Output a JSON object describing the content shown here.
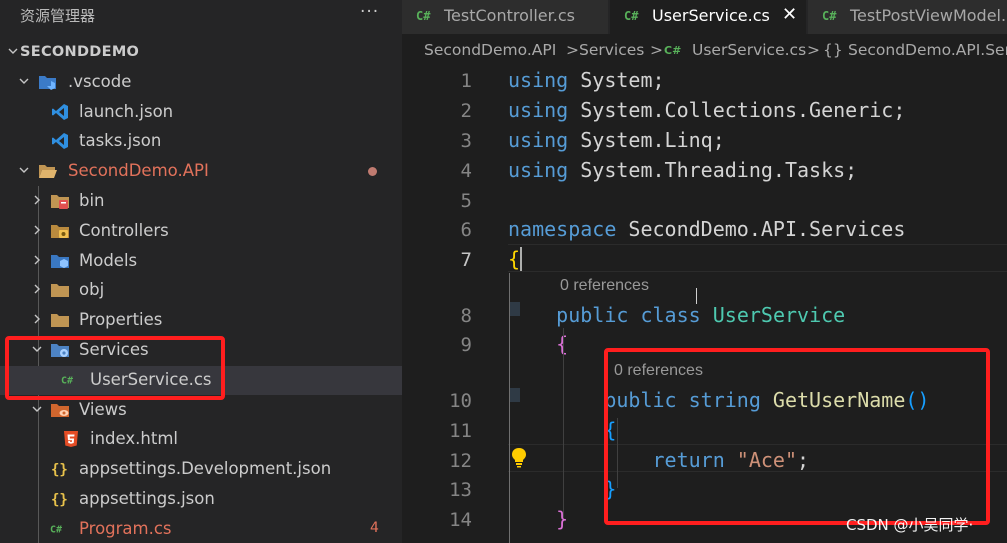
{
  "sidebar": {
    "title": "资源管理器",
    "more": "···",
    "tree": [
      {
        "label": "SECONDDEMO",
        "chevron": "down",
        "icon": "none",
        "root": true
      },
      {
        "label": ".vscode",
        "chevron": "down",
        "icon": "folder-vscode-icon"
      },
      {
        "label": "launch.json",
        "chevron": "none",
        "icon": "vscode-file-icon"
      },
      {
        "label": "tasks.json",
        "chevron": "none",
        "icon": "vscode-file-icon"
      },
      {
        "label": "SecondDemo.API",
        "chevron": "down",
        "icon": "folder-open-icon",
        "modified": true
      },
      {
        "label": "bin",
        "chevron": "right",
        "icon": "folder-bin-icon"
      },
      {
        "label": "Controllers",
        "chevron": "right",
        "icon": "folder-controllers-icon"
      },
      {
        "label": "Models",
        "chevron": "right",
        "icon": "folder-models-icon"
      },
      {
        "label": "obj",
        "chevron": "right",
        "icon": "folder-icon"
      },
      {
        "label": "Properties",
        "chevron": "right",
        "icon": "folder-icon"
      },
      {
        "label": "Services",
        "chevron": "down",
        "icon": "folder-services-icon"
      },
      {
        "label": "UserService.cs",
        "chevron": "none",
        "icon": "csharp-file-icon",
        "selected": true
      },
      {
        "label": "Views",
        "chevron": "down",
        "icon": "folder-views-icon"
      },
      {
        "label": "index.html",
        "chevron": "none",
        "icon": "html-file-icon"
      },
      {
        "label": "appsettings.Development.json",
        "chevron": "none",
        "icon": "json-file-icon"
      },
      {
        "label": "appsettings.json",
        "chevron": "none",
        "icon": "json-file-icon"
      },
      {
        "label": "Program.cs",
        "chevron": "none",
        "icon": "csharp-file-icon",
        "modified": true,
        "badge": "4"
      }
    ]
  },
  "tabs": [
    {
      "label": "TestController.cs",
      "icon_text": "C#",
      "active": false
    },
    {
      "label": "UserService.cs",
      "icon_text": "C#",
      "active": true,
      "close": "✕"
    },
    {
      "label": "TestPostViewModel.cs",
      "icon_text": "C#",
      "active": false
    }
  ],
  "breadcrumb": {
    "parts": [
      "SecondDemo.API",
      ">",
      "Services",
      ">",
      "C#",
      "UserService.cs",
      ">",
      "{}",
      "SecondDemo.API.Services"
    ]
  },
  "code": {
    "line_numbers": [
      "1",
      "2",
      "3",
      "4",
      "5",
      "6",
      "7",
      "8",
      "9",
      "10",
      "11",
      "12",
      "13",
      "14"
    ],
    "current_line": "7",
    "lines": [
      [
        [
          "kw",
          "using"
        ],
        [
          "pl",
          " System;"
        ]
      ],
      [
        [
          "kw",
          "using"
        ],
        [
          "pl",
          " System.Collections.Generic;"
        ]
      ],
      [
        [
          "kw",
          "using"
        ],
        [
          "pl",
          " System.Linq;"
        ]
      ],
      [
        [
          "kw",
          "using"
        ],
        [
          "pl",
          " System.Threading.Tasks;"
        ]
      ],
      [],
      [
        [
          "kw",
          "namespace"
        ],
        [
          "pl",
          " SecondDemo.API.Services"
        ]
      ],
      [
        [
          "br",
          "{"
        ]
      ],
      [
        [
          "pl",
          "    "
        ],
        [
          "kw",
          "public"
        ],
        [
          "pl",
          " "
        ],
        [
          "kw",
          "class"
        ],
        [
          "pl",
          " "
        ],
        [
          "ty",
          "UserService"
        ]
      ],
      [
        [
          "pl",
          "    "
        ],
        [
          "br2",
          "{"
        ]
      ],
      [
        [
          "pl",
          "        "
        ],
        [
          "kw",
          "public"
        ],
        [
          "pl",
          " "
        ],
        [
          "kw",
          "string"
        ],
        [
          "pl",
          " "
        ],
        [
          "fn",
          "GetUserName"
        ],
        [
          "br3",
          "()"
        ]
      ],
      [
        [
          "pl",
          "        "
        ],
        [
          "br3",
          "{"
        ]
      ],
      [
        [
          "pl",
          "            "
        ],
        [
          "kw",
          "return"
        ],
        [
          "pl",
          " "
        ],
        [
          "st",
          "\"Ace\""
        ],
        [
          "pl",
          ";"
        ]
      ],
      [
        [
          "pl",
          "        "
        ],
        [
          "br3",
          "}"
        ]
      ],
      [
        [
          "pl",
          "    "
        ],
        [
          "br2",
          "}"
        ]
      ]
    ],
    "lens_class": "0 references",
    "lens_method": "0 references"
  },
  "watermark": "CSDN @小吴同学·",
  "colors": {
    "keyword": "#569cd6",
    "type": "#4ec9b0",
    "function": "#dcdcaa",
    "string": "#ce9178",
    "highlight_box": "#ff1e1e",
    "modified": "#e2725b"
  }
}
